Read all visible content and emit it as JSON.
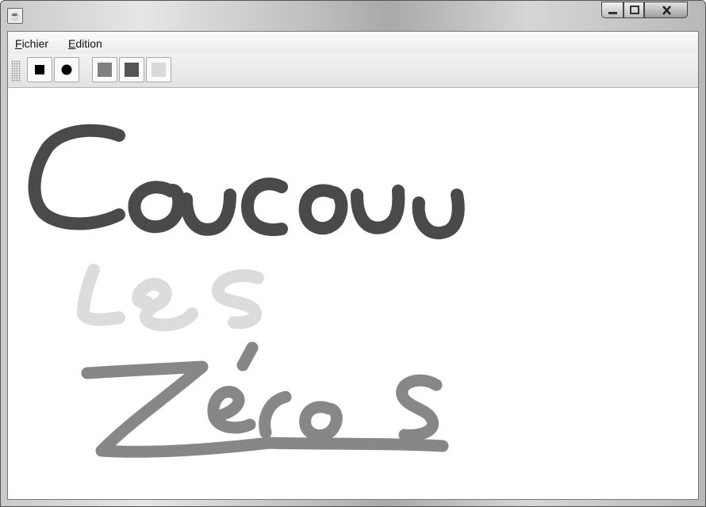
{
  "window": {
    "title": "",
    "icon": "java-coffee-cup-icon",
    "controls": [
      "minimize-icon",
      "maximize-icon",
      "close-icon"
    ]
  },
  "menu": {
    "items": [
      {
        "label": "Fichier",
        "mnemonic": "F"
      },
      {
        "label": "Edition",
        "mnemonic": "E"
      }
    ]
  },
  "toolbar": {
    "shape_buttons": [
      {
        "name": "square",
        "icon": "square-icon",
        "color": "#000000"
      },
      {
        "name": "circle",
        "icon": "circle-icon",
        "color": "#000000"
      }
    ],
    "color_buttons": [
      {
        "name": "gray",
        "color": "#808080"
      },
      {
        "name": "dark-gray",
        "color": "#555555"
      },
      {
        "name": "light-gray",
        "color": "#d9d9d9"
      }
    ]
  },
  "drawing": {
    "words": [
      {
        "text": "Coucou",
        "color": "#4a4a4a"
      },
      {
        "text": "les",
        "color": "#dcdcdc"
      },
      {
        "text": "Zéros",
        "color": "#878787"
      }
    ]
  }
}
